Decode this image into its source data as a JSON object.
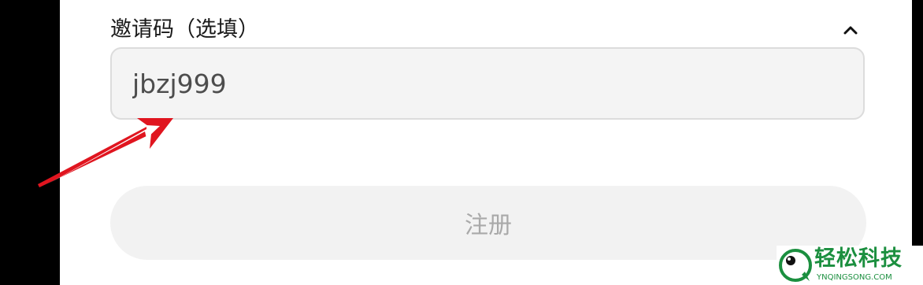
{
  "form": {
    "invite_label": "邀请码（选填）",
    "invite_value": "jbzj999",
    "collapse_icon": "chevron-up-icon",
    "register_label": "注册"
  },
  "watermark": {
    "text": "轻松科技",
    "subtext": "YNQINGSONG.COM"
  },
  "colors": {
    "background_frame": "#000000",
    "panel": "#ffffff",
    "input_background": "#f4f4f4",
    "input_border": "#dcdcdc",
    "button_background": "#f2f2f2",
    "button_text": "#a9a9a9",
    "annotation_arrow": "#e0151f",
    "watermark_green": "#1b8f3f"
  }
}
